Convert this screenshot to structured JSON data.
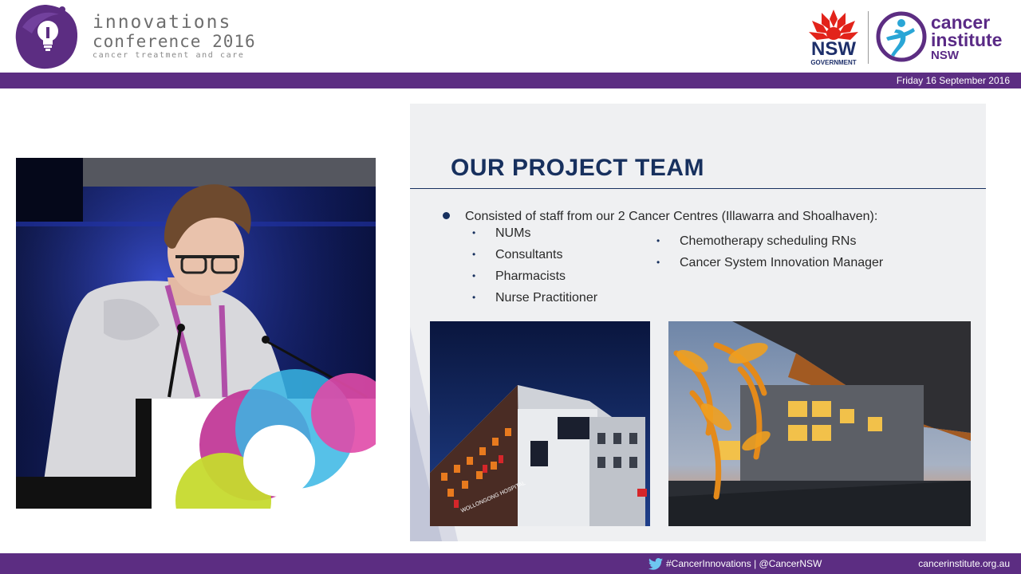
{
  "header": {
    "conference_title_line1": "innovations",
    "conference_title_line2": "conference 2016",
    "conference_tagline": "cancer treatment and care",
    "nsw_logo_word": "NSW",
    "nsw_logo_sub": "GOVERNMENT",
    "institute_line1": "cancer",
    "institute_line2": "institute",
    "institute_line3": "NSW"
  },
  "top_bar": {
    "date": "Friday 16 September 2016"
  },
  "slide": {
    "title": "OUR PROJECT TEAM",
    "main_bullet": "Consisted of staff from our 2 Cancer Centres (Illawarra and Shoalhaven):",
    "left_items": [
      "NUMs",
      "Consultants",
      "Pharmacists",
      "Nurse Practitioner"
    ],
    "right_items": [
      "Chemotherapy scheduling RNs",
      "Cancer System Innovation Manager"
    ],
    "hospital_sign": "WOLLONGONG HOSPITAL"
  },
  "bottom_bar": {
    "social": "#CancerInnovations | @CancerNSW",
    "website": "cancerinstitute.org.au"
  },
  "colors": {
    "brand_purple": "#5c2d82",
    "slide_navy": "#17305e",
    "slide_bg": "#eff0f2"
  }
}
